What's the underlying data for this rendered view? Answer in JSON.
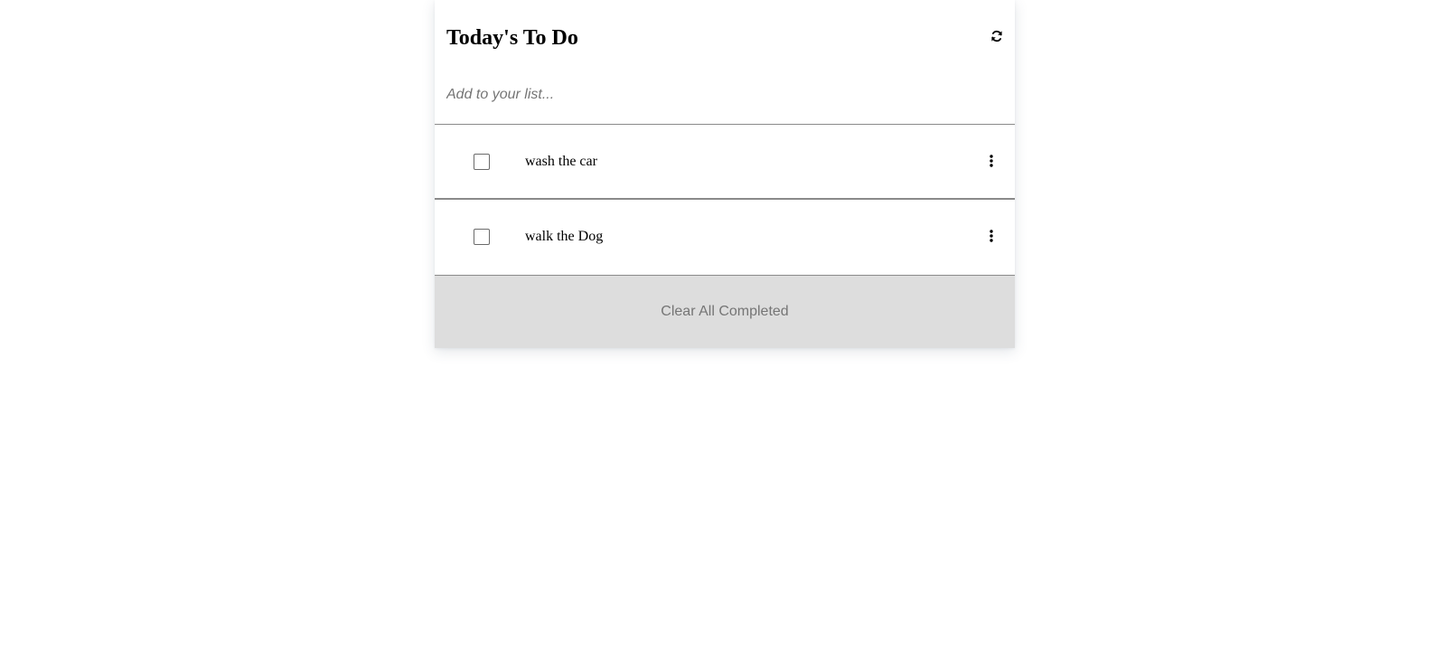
{
  "header": {
    "title": "Today's To Do",
    "refresh_icon": "refresh-icon"
  },
  "add_input": {
    "placeholder": "Add to your list...",
    "value": ""
  },
  "todos": [
    {
      "text": "wash the car",
      "checked": false,
      "menu_icon": "more-vertical-icon"
    },
    {
      "text": "walk the Dog",
      "checked": false,
      "menu_icon": "more-vertical-icon"
    }
  ],
  "footer": {
    "clear_label": "Clear All Completed"
  },
  "colors": {
    "footer_background": "#dddddd",
    "footer_text": "#757575",
    "divider": "#8a8a8a"
  }
}
